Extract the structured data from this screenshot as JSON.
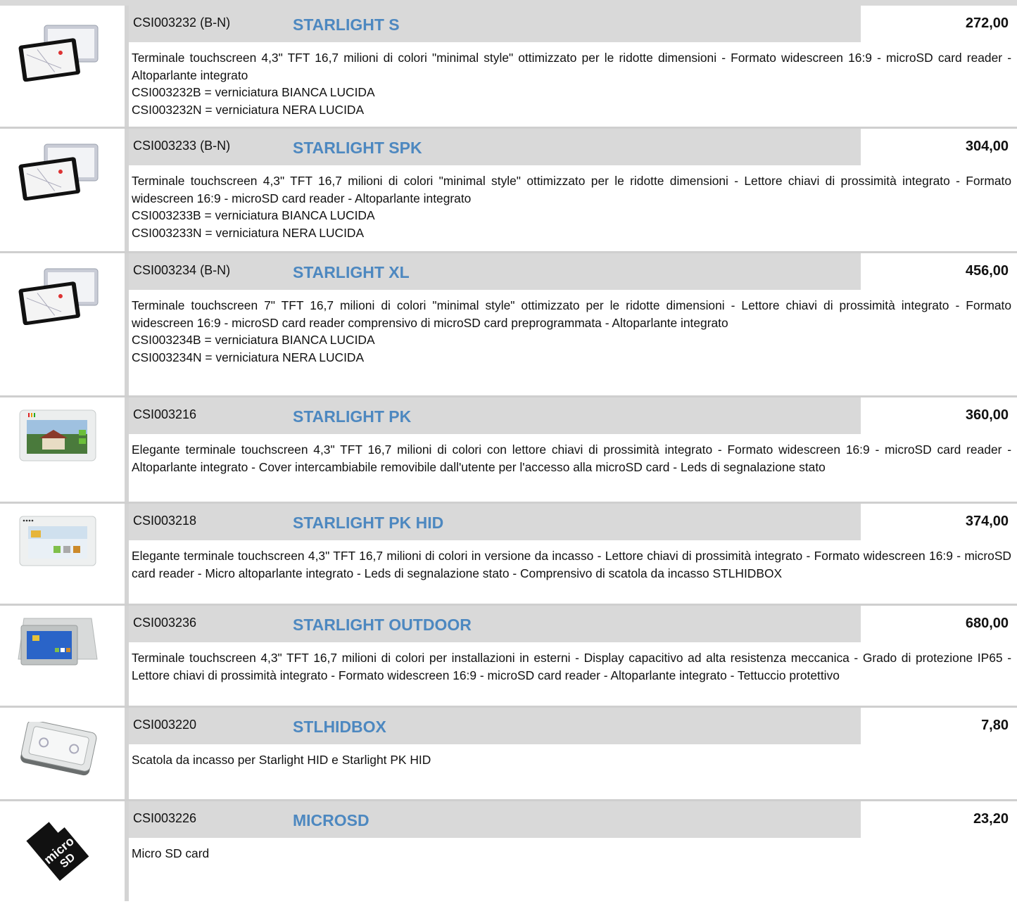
{
  "products": [
    {
      "code": "CSI003232 (B-N)",
      "name": "STARLIGHT S",
      "price": "272,00",
      "image": "terminal-pair-icon",
      "description": [
        "Terminale touchscreen 4,3\" TFT 16,7 milioni di colori \"minimal style\" ottimizzato per le ridotte dimensioni - Formato widescreen 16:9 - microSD card reader - Altoparlante integrato",
        "CSI003232B = verniciatura BIANCA LUCIDA",
        "CSI003232N = verniciatura NERA LUCIDA"
      ]
    },
    {
      "code": "CSI003233 (B-N)",
      "name": "STARLIGHT SPK",
      "price": "304,00",
      "image": "terminal-pair-icon",
      "description": [
        "Terminale touchscreen 4,3\" TFT 16,7 milioni di colori \"minimal style\" ottimizzato per le ridotte dimensioni - Lettore chiavi di prossimità integrato - Formato widescreen 16:9 - microSD card reader - Altoparlante integrato",
        "CSI003233B = verniciatura BIANCA LUCIDA",
        "CSI003233N = verniciatura NERA LUCIDA"
      ]
    },
    {
      "code": "CSI003234 (B-N)",
      "name": "STARLIGHT XL",
      "price": "456,00",
      "image": "terminal-pair-icon",
      "description": [
        "Terminale touchscreen 7\" TFT 16,7 milioni di colori \"minimal style\" ottimizzato per le ridotte dimensioni - Lettore chiavi di prossimità integrato - Formato widescreen 16:9 - microSD card reader comprensivo di microSD card preprogrammata - Altoparlante integrato",
        "CSI003234B = verniciatura BIANCA LUCIDA",
        "CSI003234N = verniciatura NERA LUCIDA"
      ]
    },
    {
      "code": "CSI003216",
      "name": "STARLIGHT PK",
      "price": "360,00",
      "image": "house-screen-terminal-icon",
      "description": [
        "Elegante terminale touchscreen 4,3\" TFT 16,7 milioni di colori con lettore chiavi di prossimità integrato - Formato widescreen 16:9 - microSD card reader - Altoparlante integrato - Cover intercambiabile removibile dall'utente per l'accesso alla microSD card - Leds di segnalazione stato"
      ]
    },
    {
      "code": "CSI003218",
      "name": "STARLIGHT PK HID",
      "price": "374,00",
      "image": "white-terminal-icon",
      "description": [
        "Elegante terminale touchscreen 4,3\" TFT 16,7 milioni di colori in versione da incasso - Lettore chiavi di prossimità integrato - Formato widescreen 16:9 - microSD card reader - Micro altoparlante integrato - Leds di segnalazione stato - Comprensivo di scatola da incasso STLHIDBOX"
      ]
    },
    {
      "code": "CSI003236",
      "name": "STARLIGHT OUTDOOR",
      "price": "680,00",
      "image": "outdoor-terminal-icon",
      "description": [
        "Terminale touchscreen 4,3\" TFT 16,7 milioni di colori per installazioni in esterni - Display capacitivo ad alta resistenza meccanica - Grado di protezione IP65 - Lettore chiavi di prossimità integrato - Formato widescreen 16:9 - microSD card reader - Altoparlante integrato - Tettuccio protettivo"
      ]
    },
    {
      "code": "CSI003220",
      "name": "STLHIDBOX",
      "price": "7,80",
      "image": "flush-box-icon",
      "description": [
        "Scatola da incasso per Starlight HID e Starlight PK HID"
      ]
    },
    {
      "code": "CSI003226",
      "name": "MICROSD",
      "price": "23,20",
      "image": "microsd-card-icon",
      "description": [
        "Micro SD card"
      ]
    }
  ]
}
